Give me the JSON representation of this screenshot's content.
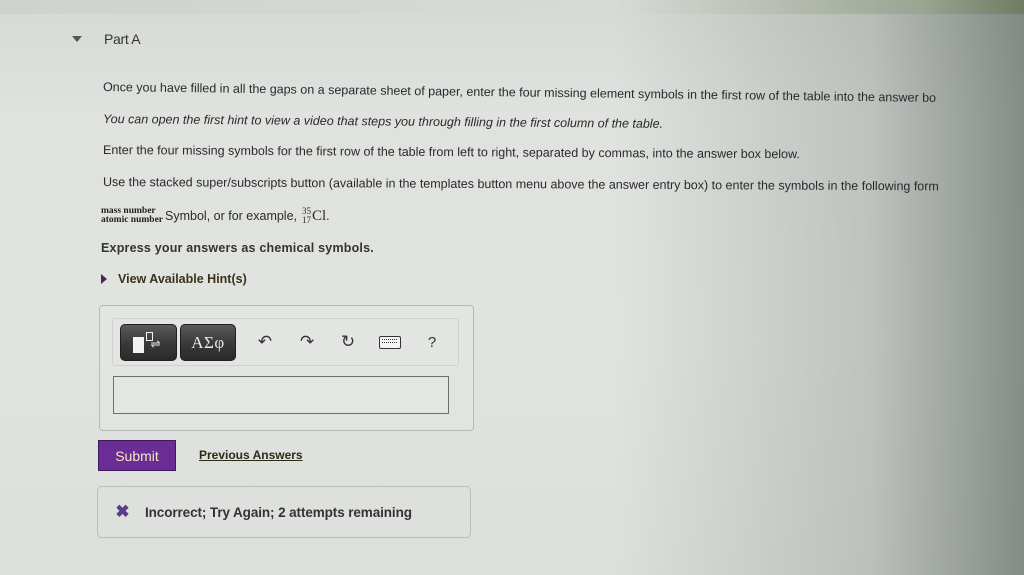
{
  "part": {
    "title": "Part A",
    "expanded": true
  },
  "instructions": {
    "line1": "Once you have filled in all the gaps on a separate sheet of paper, enter the four missing element symbols in the first row of the table into the answer bo",
    "line2": "You can open the first hint to view a video that steps you through filling in the first column of the table.",
    "line3": "Enter the four missing symbols for the first row of the table from left to right, separated by commas, into the answer box below.",
    "line4": "Use the stacked super/subscripts button (available in the templates button menu above the answer entry box) to enter the symbols in the following form",
    "format": {
      "mass_label": "mass number",
      "atomic_label": "atomic number",
      "text": "Symbol, or for example,",
      "example_mass": "35",
      "example_atomic": "17",
      "example_symbol": "Cl",
      "trailing": "."
    },
    "express": "Express your answers as chemical symbols."
  },
  "hints": {
    "label": "View Available Hint(s)"
  },
  "toolbar": {
    "templates_icon": "templates-icon",
    "greek_label": "ΑΣφ",
    "undo_icon": "undo-icon",
    "redo_icon": "redo-icon",
    "reset_icon": "reset-icon",
    "keyboard_icon": "keyboard-icon",
    "help_label": "?"
  },
  "answer": {
    "value": "",
    "placeholder": ""
  },
  "actions": {
    "submit_label": "Submit",
    "previous_answers_label": "Previous Answers"
  },
  "feedback": {
    "icon": "x-icon",
    "text": "Incorrect; Try Again; 2 attempts remaining"
  },
  "colors": {
    "submit_bg": "#6a2d96",
    "submit_text": "#f5e8c0",
    "x_icon": "#5a3b86"
  }
}
